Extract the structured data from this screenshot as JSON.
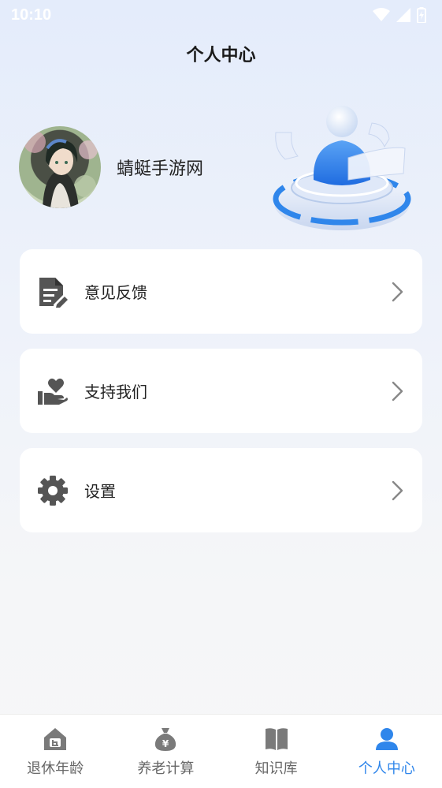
{
  "status_bar": {
    "time": "10:10"
  },
  "header": {
    "title": "个人中心"
  },
  "profile": {
    "username": "蜻蜓手游网"
  },
  "menu": [
    {
      "label": "意见反馈",
      "icon": "feedback-document-icon"
    },
    {
      "label": "支持我们",
      "icon": "support-heart-hand-icon"
    },
    {
      "label": "设置",
      "icon": "gear-icon"
    }
  ],
  "tabs": [
    {
      "label": "退休年龄",
      "icon": "house-icon",
      "active": false
    },
    {
      "label": "养老计算",
      "icon": "money-bag-icon",
      "active": false
    },
    {
      "label": "知识库",
      "icon": "book-icon",
      "active": false
    },
    {
      "label": "个人中心",
      "icon": "person-icon",
      "active": true
    }
  ],
  "colors": {
    "accent": "#2f86eb",
    "icon_gray": "#555555",
    "tab_gray": "#7a7a7a"
  }
}
